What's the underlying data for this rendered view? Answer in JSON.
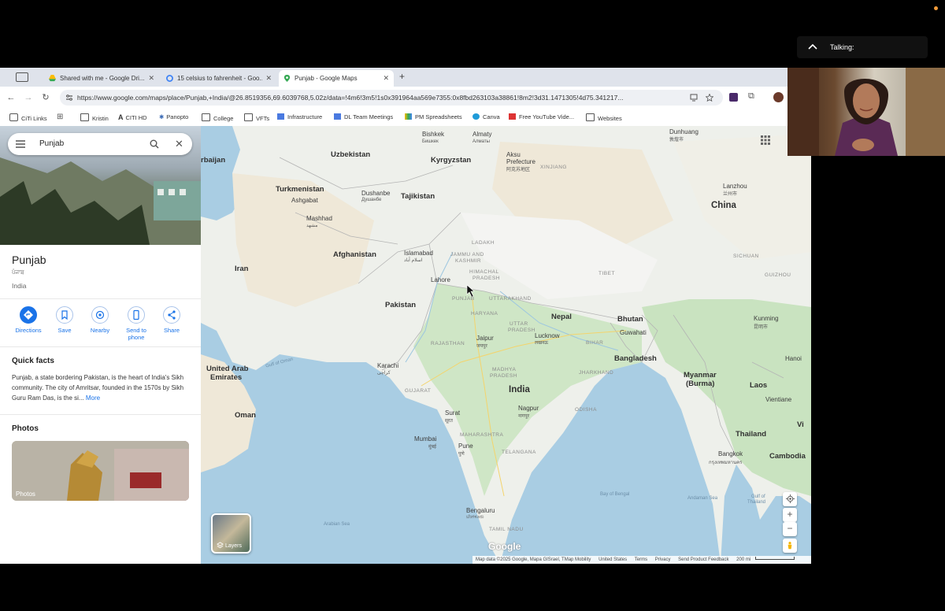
{
  "meeting": {
    "talking_label": "Talking:"
  },
  "browser": {
    "tabs": [
      {
        "label": "Shared with me - Google Dri...",
        "active": false
      },
      {
        "label": "15 celsius to fahrenheit - Goo...",
        "active": false
      },
      {
        "label": "Punjab - Google Maps",
        "active": true
      }
    ],
    "url": "https://www.google.com/maps/place/Punjab,+India/@26.8519356,69.6039768,5.02z/data=!4m6!3m5!1s0x391964aa569e7355:0x8fbd263103a38861!8m2!3d31.1471305!4d75.341217...",
    "bookmarks": [
      "CiTi Links",
      "Kristin",
      "CITI HD",
      "Panopto",
      "College",
      "VFTs",
      "Infrastructure",
      "DL Team Meetings",
      "PM Spreadsheets",
      "Canva",
      "Free YouTube Vide...",
      "Websites"
    ]
  },
  "panel": {
    "search_value": "Punjab",
    "place_title": "Punjab",
    "place_native": "ਪੰਜਾਬ",
    "place_country": "India",
    "actions": [
      {
        "label": "Directions",
        "label2": ""
      },
      {
        "label": "Save",
        "label2": ""
      },
      {
        "label": "Nearby",
        "label2": ""
      },
      {
        "label": "Send to",
        "label2": "phone"
      },
      {
        "label": "Share",
        "label2": ""
      }
    ],
    "quick_facts_heading": "Quick facts",
    "quick_facts_text": "Punjab, a state bordering Pakistan, is the heart of India's Sikh community. The city of Amritsar, founded in the 1570s by Sikh Guru Ram Das, is the si...",
    "more_label": "More",
    "photos_heading": "Photos",
    "photo_label": "Photos"
  },
  "map": {
    "labels": {
      "uzbekistan": "Uzbekistan",
      "kyrgyzstan": "Kyrgyzstan",
      "turkmenistan": "Turkmenistan",
      "tajikistan": "Tajikistan",
      "afghanistan": "Afghanistan",
      "iran": "Iran",
      "pakistan": "Pakistan",
      "nepal": "Nepal",
      "bhutan": "Bhutan",
      "bangladesh": "Bangladesh",
      "india": "India",
      "china": "China",
      "myanmar": "Myanmar",
      "burma": "(Burma)",
      "laos": "Laos",
      "thailand": "Thailand",
      "cambodia": "Cambodia",
      "uae1": "United Arab",
      "uae2": "Emirates",
      "oman": "Oman",
      "baijan": "rbaijan",
      "vi": "Vi",
      "bishkek": "Bishkek",
      "bishkek_n": "Бишкек",
      "almaty": "Almaty",
      "almaty_n": "Алматы",
      "aksu": "Aksu",
      "aksu2": "Prefecture",
      "aksu_n": "阿克苏地区",
      "xinjiang": "XINJIANG",
      "dunhuang": "Dunhuang",
      "dunhuang_n": "敦煌市",
      "ashgabat": "Ashgabat",
      "dushanbe": "Dushanbe",
      "dushanbe_n": "Душанбе",
      "mashhad": "Mashhad",
      "mashhad_n": "مشهد",
      "lanzhou": "Lanzhou",
      "lanzhou_n": "兰州市",
      "islamabad": "Islamabad",
      "islamabad_n": "اسلام آباد",
      "jk1": "JAMMU AND",
      "jk2": "KASHMIR",
      "ladakh": "LADAKH",
      "hp1": "HIMACHAL",
      "hp2": "PRADESH",
      "lahore": "Lahore",
      "punjab": "PUNJAB",
      "uttarakhand": "UTTARAKHAND",
      "haryana": "HARYANA",
      "tibet": "TIBET",
      "sichuan": "SICHUAN",
      "guizhou": "GUIZHOU",
      "up1": "UTTAR",
      "up2": "PRADESH",
      "rajasthan": "RAJASTHAN",
      "jaipur": "Jaipur",
      "jaipur_n": "जयपुर",
      "lucknow": "Lucknow",
      "lucknow_n": "लखनऊ",
      "bihar": "BIHAR",
      "guwahati": "Guwahati",
      "karachi": "Karachi",
      "karachi_n": "کراچی",
      "gulf_oman": "Gulf of Oman",
      "gujarat": "GUJARAT",
      "jharkhand": "JHARKHAND",
      "mp1": "MADHYA",
      "mp2": "PRADESH",
      "kunming": "Kunming",
      "kunming_n": "昆明市",
      "hanoi": "Hanoi",
      "surat": "Surat",
      "surat_n": "सूरत",
      "nagpur": "Nagpur",
      "nagpur_n": "नागपूर",
      "odisha": "ODISHA",
      "maharashtra": "MAHARASHTRA",
      "mumbai": "Mumbai",
      "mumbai_n": "मुंबई",
      "pune": "Pune",
      "pune_n": "पुणे",
      "telangana": "TELANGANA",
      "vientiane": "Vientiane",
      "bangkok": "Bangkok",
      "bangkok_n": "กรุงเทพมหานคร",
      "bay_bengal": "Bay of Bengal",
      "andaman": "Andaman Sea",
      "gulf_thai1": "Gulf of",
      "gulf_thai2": "Thailand",
      "arabian_sea": "Arabian Sea",
      "bengaluru": "Bengaluru",
      "bengaluru_n": "ಬೆಂಗಳೂರು",
      "tamil_nadu": "TAMIL NADU"
    },
    "layers_label": "Layers",
    "google_logo": "Google",
    "zoom_in": "+",
    "zoom_out": "−",
    "footer": {
      "attribution": "Map data ©2025 Google, Mapa GISrael, TMap Mobility",
      "country": "United States",
      "terms": "Terms",
      "privacy": "Privacy",
      "feedback": "Send Product Feedback",
      "scale": "200 mi"
    }
  },
  "colors": {
    "accent": "#1a73e8",
    "water": "#a9cde3",
    "land": "#eef0eb",
    "green": "#c9e3c0",
    "desert": "#efe8d8"
  }
}
